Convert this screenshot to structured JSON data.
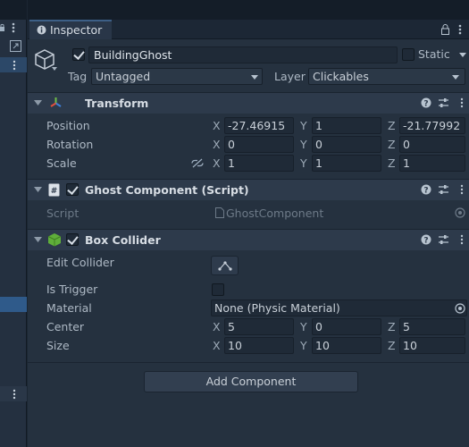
{
  "inspector": {
    "tab_label": "Inspector"
  },
  "object": {
    "name": "BuildingGhost",
    "active": true,
    "static_label": "Static",
    "static": false,
    "tag_label": "Tag",
    "tag_value": "Untagged",
    "layer_label": "Layer",
    "layer_value": "Clickables"
  },
  "transform": {
    "title": "Transform",
    "rows": [
      {
        "label": "Position",
        "x": "-27.46915",
        "y": "1",
        "z": "-21.77992"
      },
      {
        "label": "Rotation",
        "x": "0",
        "y": "0",
        "z": "0"
      },
      {
        "label": "Scale",
        "x": "1",
        "y": "1",
        "z": "1"
      }
    ]
  },
  "ghost_component": {
    "title": "Ghost Component (Script)",
    "enabled": true,
    "script_label": "Script",
    "script_value": "GhostComponent"
  },
  "box_collider": {
    "title": "Box Collider",
    "enabled": true,
    "edit_collider_label": "Edit Collider",
    "is_trigger_label": "Is Trigger",
    "is_trigger": false,
    "material_label": "Material",
    "material_value": "None (Physic Material)",
    "center_label": "Center",
    "center": {
      "x": "5",
      "y": "0",
      "z": "5"
    },
    "size_label": "Size",
    "size": {
      "x": "10",
      "y": "10",
      "z": "10"
    }
  },
  "axes": {
    "x": "X",
    "y": "Y",
    "z": "Z"
  },
  "add_component_label": "Add Component",
  "colors": {
    "accent": "#3d5f86",
    "panel": "#25313f",
    "header": "#2d3a4b",
    "field": "#1f2a37"
  }
}
